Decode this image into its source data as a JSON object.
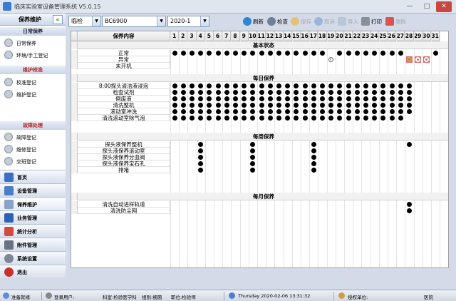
{
  "window": {
    "title": "临床实验室设备管理系统 V5.0.15"
  },
  "sidebar": {
    "header": "保养维护",
    "collapse_glyph": "«",
    "groups": [
      {
        "title": "日常保养",
        "items": [
          "日常保养",
          "环境/手工登记"
        ]
      },
      {
        "title": "维护校准",
        "items": [
          "校准登记",
          "维护登记"
        ]
      },
      {
        "title": "故障处理",
        "items": [
          "故障登记",
          "维修登记",
          "交班登记"
        ]
      }
    ],
    "nav": [
      "首页",
      "设备管理",
      "保养维护",
      "业务管理",
      "统计分析",
      "附件管理",
      "系统设置",
      "退出"
    ],
    "active_nav": 2
  },
  "toolbar": {
    "dept": "临检",
    "device": "BC6900",
    "month": "2020-1",
    "buttons": [
      "刷新",
      "检查",
      "保存",
      "取消",
      "导入",
      "打印",
      "删除"
    ]
  },
  "grid": {
    "content_header": "保养内容",
    "days": [
      "1",
      "2",
      "3",
      "4",
      "5",
      "6",
      "7",
      "8",
      "9",
      "10",
      "11",
      "12",
      "13",
      "14",
      "15",
      "16",
      "17",
      "18",
      "19",
      "20",
      "21",
      "22",
      "23",
      "24",
      "25",
      "26",
      "27",
      "28",
      "29",
      "30",
      "31"
    ],
    "sections": [
      {
        "title": "基本状态",
        "rows": [
          "正常",
          "异常",
          "未开机"
        ]
      },
      {
        "title": "每日保养",
        "rows": [
          "8:00探头清洁液浸泡",
          "检查试剂",
          "倒废液",
          "清洗整机",
          "滚动室冲洗",
          "清洗滚动室除气泡"
        ]
      },
      {
        "title": "每周保养",
        "rows": [
          "探头液保养整机",
          "探头液保养滚动室",
          "探头液保养分血阀",
          "探头液保养宝石孔",
          "排堵"
        ]
      },
      {
        "title": "每月保养",
        "rows": [
          "清洗自动进样轨道",
          "清洗防尘网"
        ]
      }
    ],
    "marks": {
      "正常": [
        1,
        2,
        3,
        4,
        5,
        6,
        7,
        8,
        9,
        10,
        11,
        12,
        13,
        14,
        15,
        16,
        17,
        18,
        20,
        21,
        22,
        23,
        24,
        25,
        26,
        27,
        31
      ],
      "异常_circle": [
        19
      ],
      "异常_red": [
        28,
        29,
        30
      ],
      "daily_full": [
        1,
        2,
        3,
        4,
        5,
        6,
        7,
        8,
        9,
        10,
        11,
        12,
        13,
        14,
        15,
        16,
        17,
        18,
        19,
        20,
        21,
        22,
        23,
        24,
        25,
        26,
        27,
        28
      ],
      "daily_last": [
        1,
        2,
        3,
        4,
        5,
        6,
        7,
        8,
        9,
        10,
        11,
        12,
        13,
        14,
        15,
        16,
        17,
        18,
        19,
        20,
        21,
        22,
        23,
        24,
        25,
        26,
        27
      ],
      "weekly": [
        4,
        10,
        17,
        28
      ],
      "monthly": [
        28
      ]
    }
  },
  "status": {
    "ready": "准备就绪",
    "user": "登录用户:",
    "office": "科室:检验医学科",
    "group": "组别:细菌",
    "position": "职位:检验师",
    "datetime": "Thursday 2020-02-06 13:31:32",
    "licensed": "授权单位:",
    "hospital": "医院"
  }
}
